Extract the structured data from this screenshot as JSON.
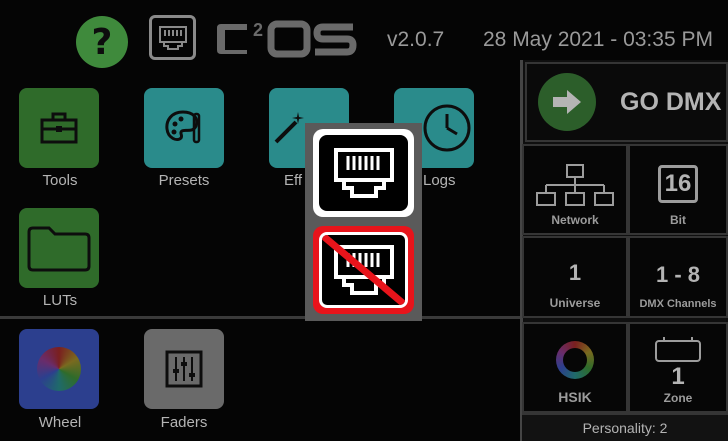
{
  "header": {
    "help_icon": "question-mark-icon",
    "help_glyph": "?",
    "network_icon": "ethernet-port-icon",
    "logo_text": "C2OS",
    "version": "v2.0.7",
    "datetime": "28 May 2021 - 03:35 PM"
  },
  "apps": [
    {
      "label": "Tools",
      "icon": "toolbox-icon",
      "color": "#2f6b2a"
    },
    {
      "label": "Presets",
      "icon": "palette-icon",
      "color": "#2a8b8b"
    },
    {
      "label": "Effects",
      "icon": "magic-wand-icon",
      "color": "#2a8b8b"
    },
    {
      "label": "Logs",
      "icon": "clock-icon",
      "color": "#2a8b8b"
    },
    {
      "label": "LUTs",
      "icon": "folder-icon",
      "color": "#2f6b2a"
    },
    {
      "label": "Wheel",
      "icon": "color-wheel-icon",
      "color": "#2c3f8e"
    },
    {
      "label": "Faders",
      "icon": "faders-icon",
      "color": "#6a6a6a"
    }
  ],
  "effects_visible_label": "Eff",
  "right_panel": {
    "go_dmx_label": "GO DMX",
    "network_label": "Network",
    "bit_value": "16",
    "bit_label": "Bit",
    "universe_value": "1",
    "universe_label": "Universe",
    "dmx_channels_value": "1 - 8",
    "dmx_channels_label": "DMX Channels",
    "mode_label": "HSIK",
    "zone_value": "1",
    "zone_label": "Zone",
    "personality": "Personality: 2"
  },
  "popup": {
    "option_enabled_icon": "ethernet-enabled-icon",
    "option_disabled_icon": "ethernet-disabled-icon"
  }
}
